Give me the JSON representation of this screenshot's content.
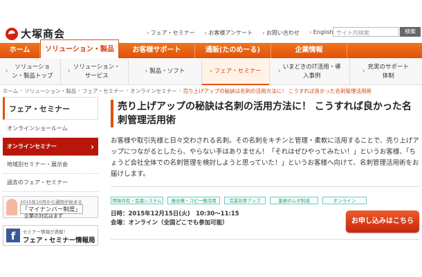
{
  "header": {
    "logo_text": "大塚商会",
    "top_links": [
      "フェア・セミナー",
      "お客様アンケート",
      "お問い合わせ",
      "English"
    ],
    "search_placeholder": "サイト内検索",
    "search_button": "検索"
  },
  "main_nav": [
    {
      "label": "ホーム",
      "active": false
    },
    {
      "label": "ソリューション・製品",
      "active": true
    },
    {
      "label": "お客様サポート",
      "active": false
    },
    {
      "label": "通販(たのめーる)",
      "active": false
    },
    {
      "label": "企業情報",
      "active": false
    }
  ],
  "sub_nav": [
    {
      "label": "ソリューション・製品トップ",
      "active": false
    },
    {
      "label": "ソリューション・サービス",
      "active": false
    },
    {
      "label": "製品・ソフト",
      "active": false
    },
    {
      "label": "フェア・セミナー",
      "active": true
    },
    {
      "label": "いまどきのIT活用・導入事例",
      "active": false
    },
    {
      "label": "充実のサポート体制",
      "active": false
    }
  ],
  "breadcrumb": [
    "ホーム",
    "ソリューション・製品",
    "フェア・セミナー",
    "オンラインセミナー",
    "売り上げアップの秘訣は名刺の活用方法に！ こうすれば良かった名刺管理活用術"
  ],
  "sidebar": {
    "title": "フェア・セミナー",
    "items": [
      {
        "label": "オンラインショールーム",
        "active": false
      },
      {
        "label": "オンラインセミナー",
        "active": true
      },
      {
        "label": "地域別セミナー・展示会",
        "active": false
      },
      {
        "label": "過去のフェア・セミナー",
        "active": false
      }
    ],
    "banner1": {
      "small": "2015年10月から通知が始まる",
      "big": "「マイナンバー制度」",
      "sub": "企業の対応はまず"
    },
    "banner2": {
      "small": "セミナー情報が満載！",
      "big": "フェア・セミナー情報局"
    }
  },
  "content": {
    "title": "売り上げアップの秘訣は名刺の活用方法に！ こうすれば良かった名刺管理活用術",
    "body": "お客様や取引先様と日々交わされる名刺。その名刺をキチンと管理・柔軟に活用することで、売り上げアップにつながるとしたら、やらない手はありません！「それはぜひやってみたい！」というお客様、「ちょうど会社全体での名刺管理を検討しようと思っていた！」というお客様へ向けて、名刺管理活用術をお届けします。",
    "tags": [
      "情報共有・会議システム",
      "複合機・コピー機活用",
      "営業効率アップ",
      "業務のムダ削減",
      "オンライン"
    ],
    "datetime_label": "日時：",
    "datetime_value": "2015年12月15日(火)　10:30～11:15",
    "venue_label": "会場：",
    "venue_value": "オンライン（全国どこでも参加可能）",
    "apply_button": "お申し込みはこちら"
  }
}
